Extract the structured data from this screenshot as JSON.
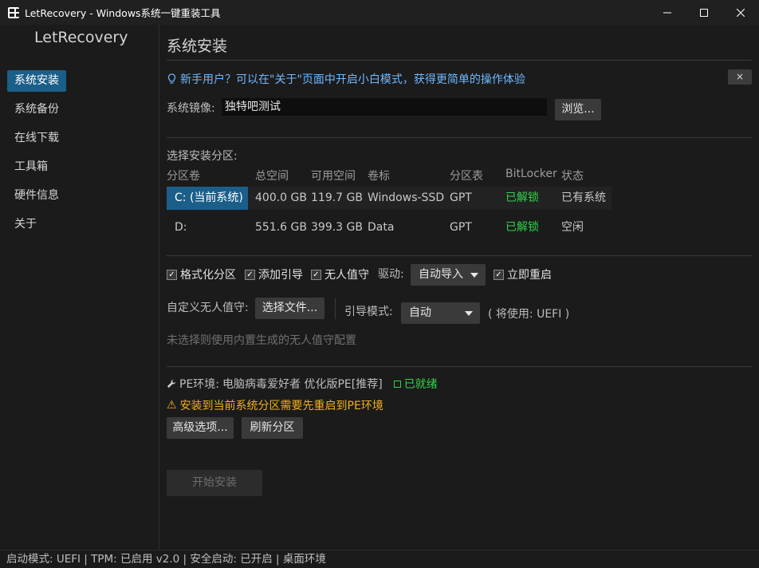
{
  "window": {
    "title": "LetRecovery - Windows系统一键重装工具",
    "icon": "app-icon"
  },
  "sidebar": {
    "logo": "LetRecovery",
    "items": [
      {
        "label": "系统安装",
        "active": true
      },
      {
        "label": "系统备份"
      },
      {
        "label": "在线下载"
      },
      {
        "label": "工具箱"
      },
      {
        "label": "硬件信息"
      },
      {
        "label": "关于"
      }
    ]
  },
  "main": {
    "page_title": "系统安装",
    "tip": {
      "icon": "lightbulb-icon",
      "text": "新手用户？可以在\"关于\"页面中开启小白模式，获得更简单的操作体验",
      "close": "×"
    },
    "image": {
      "label": "系统镜像:",
      "value": "独特吧测试",
      "browse": "浏览..."
    },
    "partition": {
      "label": "选择安装分区:",
      "columns": [
        "分区卷",
        "总空间",
        "可用空间",
        "卷标",
        "分区表",
        "BitLocker",
        "状态"
      ],
      "rows": [
        [
          "C: (当前系统)",
          "400.0 GB",
          "119.7 GB",
          "Windows-SSD",
          "GPT",
          "已解锁",
          "已有系统"
        ],
        [
          "D:",
          "551.6 GB",
          "399.3 GB",
          "Data",
          "GPT",
          "已解锁",
          "空闲"
        ]
      ]
    },
    "options": {
      "format": "格式化分区",
      "add_boot": "添加引导",
      "unattended": "无人值守",
      "driver_label": "驱动:",
      "driver_value": "自动导入",
      "restart": "立即重启"
    },
    "custom": {
      "label": "自定义无人值守:",
      "choose": "选择文件...",
      "boot_mode_label": "引导模式:",
      "boot_mode_value": "自动",
      "will_use": "( 将使用: UEFI )",
      "hint": "未选择则使用内置生成的无人值守配置"
    },
    "pe": {
      "icon": "wrench-icon",
      "label": "PE环境:",
      "name": "电脑病毒爱好者 优化版PE[推荐]",
      "status": "已就绪",
      "warning": "安装到当前系统分区需要先重启到PE环境",
      "warning_icon": "warning-icon"
    },
    "buttons": {
      "advanced": "高级选项...",
      "refresh": "刷新分区",
      "start": "开始安装"
    }
  },
  "statusbar": {
    "text": "启动模式: UEFI | TPM: 已启用 v2.0 | 安全启动: 已开启 | 桌面环境"
  },
  "colors": {
    "accent": "#1b5e8a",
    "tip": "#6fb8ff",
    "ok": "#33d14a",
    "warning": "#f0b020"
  }
}
